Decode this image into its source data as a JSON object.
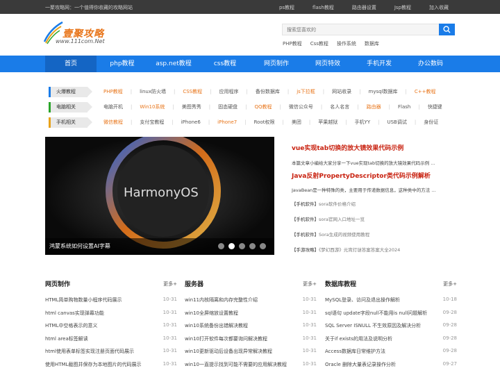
{
  "topbar": {
    "slogan": "一聚攻略网：一个值得你收藏的攻略网站",
    "links": [
      "ps教程",
      "flash教程",
      "路由器设置",
      "Jsp教程",
      "加入收藏"
    ]
  },
  "logo": {
    "name": "壹聚攻略",
    "url": "www.111com.Net"
  },
  "search": {
    "placeholder": "搜索您喜欢的"
  },
  "hot_keywords": [
    "PHP教程",
    "Css教程",
    "操作系统",
    "数据库"
  ],
  "nav": [
    "首页",
    "php教程",
    "asp.net教程",
    "css教程",
    "网页制作",
    "网页特效",
    "手机开发",
    "办公数码"
  ],
  "categories": [
    {
      "label": "火爆教程",
      "items": [
        {
          "t": "PHP教程",
          "hl": true
        },
        {
          "t": "linux防火墙"
        },
        {
          "t": "CSS教程",
          "hl": true
        },
        {
          "t": "应用程序"
        },
        {
          "t": "备份数据库"
        },
        {
          "t": "js下拉框",
          "hl": true
        },
        {
          "t": "网站收录"
        },
        {
          "t": "mysql数据库"
        },
        {
          "t": "C++教程",
          "hl": true
        }
      ]
    },
    {
      "label": "电脑相关",
      "items": [
        {
          "t": "电脑开机"
        },
        {
          "t": "Win10系统",
          "hl": true
        },
        {
          "t": "美图秀秀"
        },
        {
          "t": "固态硬盘"
        },
        {
          "t": "QQ教程",
          "hl": true
        },
        {
          "t": "微信公众号"
        },
        {
          "t": "名人名言"
        },
        {
          "t": "路由器",
          "hl": true
        },
        {
          "t": "Flash"
        },
        {
          "t": "快捷键"
        }
      ]
    },
    {
      "label": "手机相关",
      "items": [
        {
          "t": "微信教程",
          "hl": true
        },
        {
          "t": "支付宝教程"
        },
        {
          "t": "iPhone6"
        },
        {
          "t": "iPhone7",
          "hl": true
        },
        {
          "t": "Root权限"
        },
        {
          "t": "美团"
        },
        {
          "t": "苹果越狱"
        },
        {
          "t": "手机YY"
        },
        {
          "t": "USB调试"
        },
        {
          "t": "身份证"
        }
      ]
    }
  ],
  "slider": {
    "caption": "鸿蒙系统如何设置AI字幕",
    "brand": "HarmonyOS",
    "active_dot": 2,
    "dot_count": 5
  },
  "headlines": [
    {
      "title": "vue实现tab切换的放大镜效果代码示例",
      "summary": "本篇文章小编给大家分享一下vue实现tab切换的放大镜效果代码示例 ..."
    },
    {
      "title": "Java反射PropertyDescriptor类代码示例解析",
      "summary": "JavaBean是一种特殊的类，主要用于传递数据信息，这种类中的方法 ..."
    }
  ],
  "news": [
    {
      "tag": "【手机软件】",
      "title": "sora软件价格介绍"
    },
    {
      "tag": "【手机软件】",
      "title": "sora官网入口地址一览"
    },
    {
      "tag": "【手机软件】",
      "title": "Sora生成的视频使用教程"
    },
    {
      "tag": "【手游攻略】",
      "title": "《梦幻西游》元宵灯谜答案答案大全2024"
    }
  ],
  "columns": [
    {
      "title": "网页制作",
      "more": "更多+",
      "rows": [
        {
          "t": "HTML简单购物数量小程序代码展示",
          "d": "10-31"
        },
        {
          "t": "html canvas实现弹幕功能",
          "d": "10-31"
        },
        {
          "t": "HTML中空格表示的意义",
          "d": "10-31"
        },
        {
          "t": "html area标签解读",
          "d": "10-31"
        },
        {
          "t": "html使用表单标签实现注册页面代码展示",
          "d": "10-31"
        },
        {
          "t": "使用HTML截图并保存为本地图片的代码展示",
          "d": "10-31"
        }
      ]
    },
    {
      "title": "服务器",
      "more": "更多+",
      "rows": [
        {
          "t": "win11内核隔离和内存完整性介绍",
          "d": "10-31"
        },
        {
          "t": "win10全屏缩放设置教程",
          "d": "10-31"
        },
        {
          "t": "win10系统备份出错解决教程",
          "d": "10-31"
        },
        {
          "t": "win10打开软件每次都要询问解决教程",
          "d": "10-31"
        },
        {
          "t": "win10更新驱动后设备出现异常解决教程",
          "d": "10-31"
        },
        {
          "t": "win10一直提示找到可能不需要的应用解决教程",
          "d": "10-31"
        }
      ]
    },
    {
      "title": "数据库教程",
      "more": "更多+",
      "rows": [
        {
          "t": "MySQL登录、访问及退出操作解析",
          "d": "10-18"
        },
        {
          "t": "sql语句 update字段null不能用is null问题解析",
          "d": "09-28"
        },
        {
          "t": "SQL Server ISNULL 不生效原因及解决分析",
          "d": "09-28"
        },
        {
          "t": "关于if exists的用法及说明分析",
          "d": "09-28"
        },
        {
          "t": "Access数据库日常维护方法",
          "d": "09-28"
        },
        {
          "t": "Oracle 删除大量表记录操作分析",
          "d": "09-27"
        }
      ]
    }
  ]
}
